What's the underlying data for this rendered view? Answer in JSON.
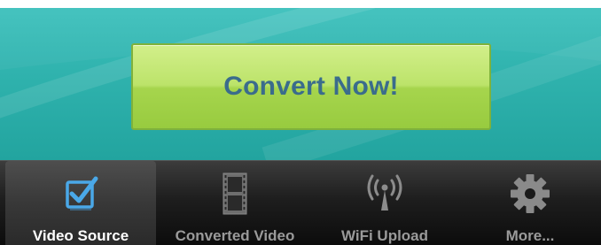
{
  "main": {
    "convert_button_label": "Convert Now!"
  },
  "tab_bar": {
    "selected_index": 0,
    "tabs": [
      {
        "label": "Video Source",
        "icon": "checkbox-icon",
        "selected": true
      },
      {
        "label": "Converted Video",
        "icon": "film-strip-icon",
        "selected": false
      },
      {
        "label": "WiFi Upload",
        "icon": "wifi-antenna-icon",
        "selected": false
      },
      {
        "label": "More...",
        "icon": "gear-icon",
        "selected": false
      }
    ]
  },
  "colors": {
    "teal_background": "#2fb2ad",
    "button_green": "#b3df62",
    "button_text": "#3a6c8c",
    "selected_icon_blue": "#4aa8e8",
    "tab_bar_dark": "#1e1e1e"
  }
}
